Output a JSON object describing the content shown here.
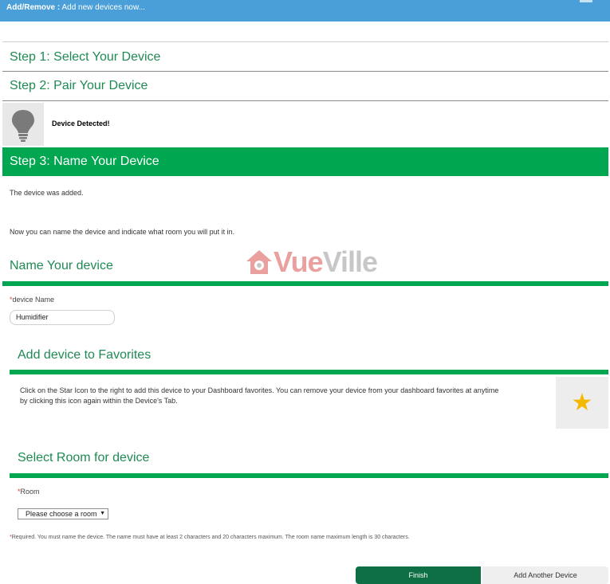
{
  "topbar": {
    "prefix": "Add/Remove :",
    "subtitle": "Add new devices now..."
  },
  "steps": {
    "step1": "Step 1: Select Your Device",
    "step2": "Step 2: Pair Your Device",
    "step3": "Step 3: Name Your Device"
  },
  "pair": {
    "icon": "lightbulb-icon",
    "status": "Device Detected!"
  },
  "messages": {
    "added": "The device was added.",
    "instruction": "Now you can name the device and indicate what room you will put it in."
  },
  "name_section": {
    "title": "Name Your device",
    "label": "device Name",
    "required_marker": "*",
    "value": "Humidifier"
  },
  "favorites_section": {
    "title": "Add device to Favorites",
    "description": "Click on the Star Icon to the right to add this device to your Dashboard favorites. You can remove your device from your dashboard favorites at anytime by clicking this icon again within the Device's Tab.",
    "icon": "star-icon",
    "star_color": "#f5b800"
  },
  "room_section": {
    "title": "Select Room for device",
    "label": "Room",
    "required_marker": "*",
    "selected": "Please choose a room"
  },
  "note": {
    "marker": "*",
    "text": "Required. You must name the device. The name must have at least 2 characters and 20 characters maximum. The room name maximum length is 30 characters."
  },
  "buttons": {
    "finish": "Finish",
    "add_another": "Add Another Device"
  },
  "watermark": {
    "text_prefix": "Vue",
    "text_suffix": "Ville"
  },
  "colors": {
    "accent_green": "#00a650",
    "finish_green": "#0e6e44",
    "topbar_blue": "#4a9fd8"
  }
}
